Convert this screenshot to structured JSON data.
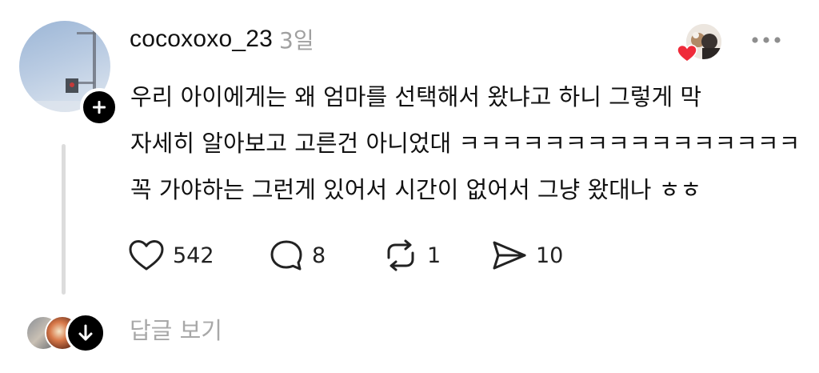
{
  "post": {
    "username": "cocoxoxo_23",
    "timestamp": "3일",
    "body_lines": [
      "우리 아이에게는 왜 엄마를 선택해서 왔냐고 하니 그렇게 막",
      "자세히 알아보고 고른건 아니었대 ㅋㅋㅋㅋㅋㅋㅋㅋㅋㅋㅋㅋㅋㅋㅋㅋ",
      "꼭 가야하는 그런게 있어서 시간이 없어서 그냥 왔대나 ㅎㅎ"
    ],
    "actions": {
      "like_count": "542",
      "reply_count": "8",
      "repost_count": "1",
      "share_count": "10"
    },
    "icons": {
      "follow": "plus-icon",
      "more": "more-horizontal-icon",
      "like": "heart-outline-icon",
      "reply": "speech-bubble-icon",
      "repost": "repost-icon",
      "share": "send-icon",
      "liked_by": "heart-filled-icon",
      "expand": "arrow-down-icon"
    }
  },
  "replies": {
    "view_label": "답글 보기"
  },
  "colors": {
    "text_primary": "#111111",
    "text_secondary": "#a0a0a0",
    "heart_red": "#ef2b3a",
    "button_black": "#000000",
    "thread_line": "#dcdcdc"
  }
}
